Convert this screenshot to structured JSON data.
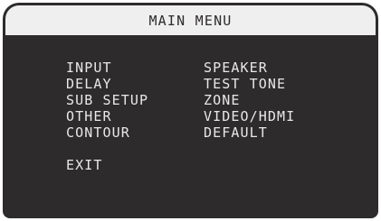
{
  "title": "MAIN MENU",
  "left_items": [
    "INPUT",
    "DELAY",
    "SUB SETUP",
    "OTHER",
    "CONTOUR"
  ],
  "right_items": [
    "SPEAKER",
    "TEST TONE",
    "ZONE",
    "VIDEO/HDMI",
    "DEFAULT"
  ],
  "exit_label": "EXIT",
  "colors": {
    "screen_background": "#2e2b2c",
    "title_bar": "#efefef",
    "menu_text": "#e8e8e8"
  }
}
